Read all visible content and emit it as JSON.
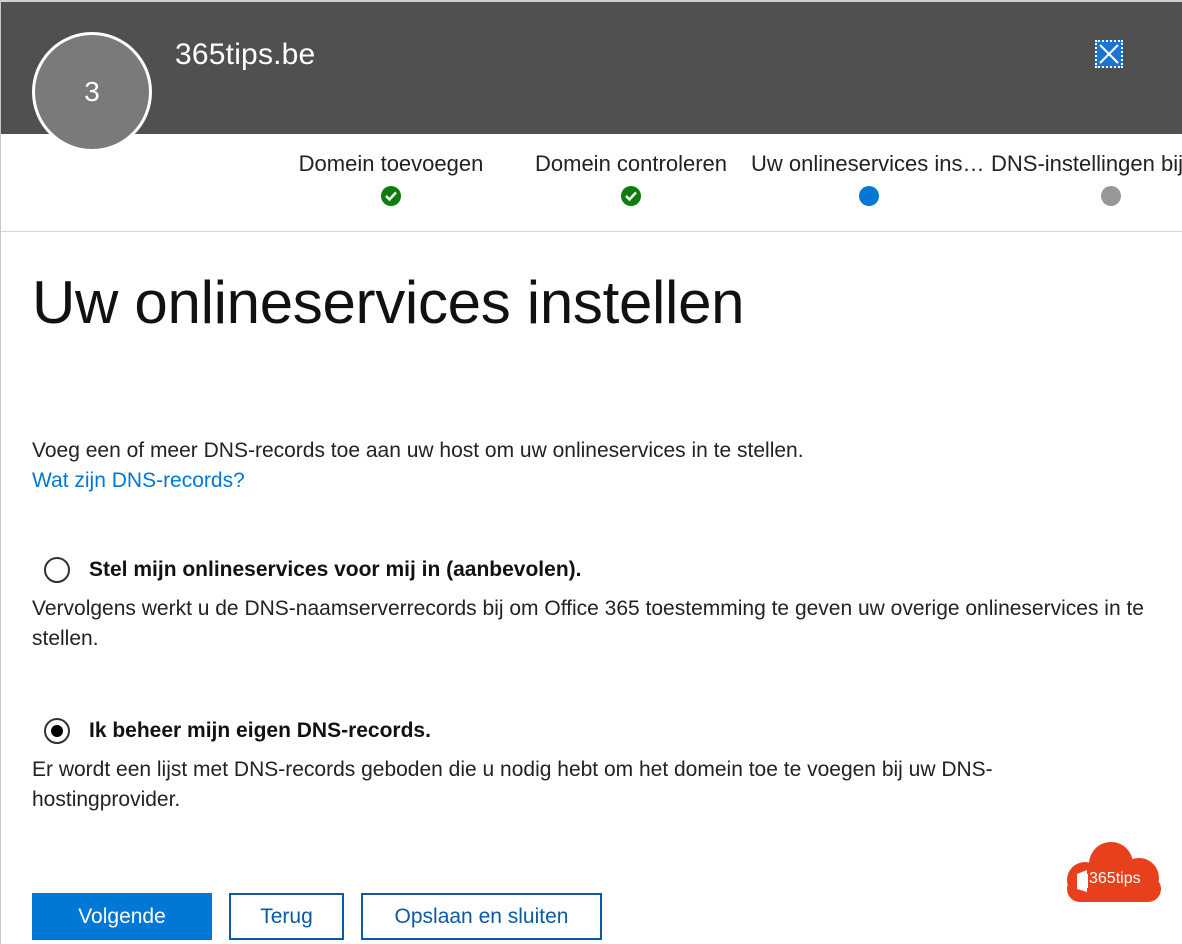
{
  "header": {
    "avatar_text": "3",
    "brand": "365tips.be"
  },
  "steps": [
    {
      "label": "Domein toevoegen",
      "state": "done"
    },
    {
      "label": "Domein controleren",
      "state": "done"
    },
    {
      "label": "Uw onlineservices instellen",
      "state": "current"
    },
    {
      "label": "DNS-instellingen bijwerken",
      "state": "todo"
    }
  ],
  "main": {
    "title": "Uw onlineservices instellen",
    "intro": "Voeg een of meer DNS-records toe aan uw host om uw onlineservices in te stellen.",
    "link": "Wat zijn DNS-records?",
    "options": [
      {
        "label": "Stel mijn onlineservices voor mij in (aanbevolen).",
        "description_line1": "Vervolgens werkt u de DNS-naamserverrecords bij om Office 365 toestemming te geven uw overige onlineservices in te",
        "description_line2": "stellen.",
        "checked": false
      },
      {
        "label": "Ik beheer mijn eigen DNS-records.",
        "description_line1": "Er wordt een lijst met DNS-records geboden die u nodig hebt om het domein toe te voegen bij uw DNS-",
        "description_line2": "hostingprovider.",
        "checked": true
      }
    ]
  },
  "buttons": {
    "next": "Volgende",
    "back": "Terug",
    "save_close": "Opslaan en sluiten"
  },
  "watermark": {
    "text": "365tips",
    "color": "#e8401c"
  },
  "colors": {
    "header_bg": "#505050",
    "accent": "#0078d4",
    "done": "#107c10",
    "todo": "#979797"
  }
}
